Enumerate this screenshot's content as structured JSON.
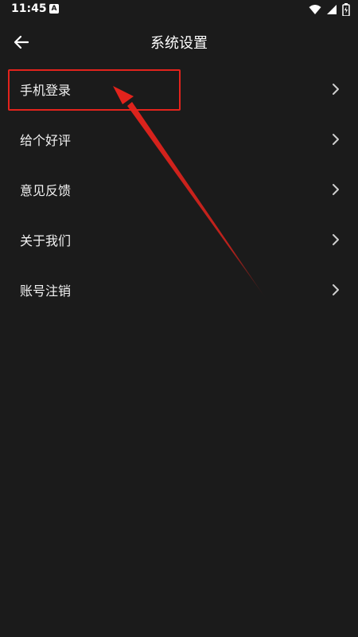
{
  "status_bar": {
    "time": "11:45",
    "app_icon_letter": "A",
    "icons": [
      "wifi-icon",
      "signal-icon",
      "battery-icon"
    ]
  },
  "header": {
    "title": "系统设置",
    "back_icon": "arrow-left-icon"
  },
  "settings_items": [
    {
      "label": "手机登录"
    },
    {
      "label": "给个好评"
    },
    {
      "label": "意见反馈"
    },
    {
      "label": "关于我们"
    },
    {
      "label": "账号注销"
    }
  ],
  "colors": {
    "background": "#1b1b1b",
    "text": "#ffffff",
    "chevron": "#cfcfcf",
    "annotation_red": "#e3231c"
  }
}
